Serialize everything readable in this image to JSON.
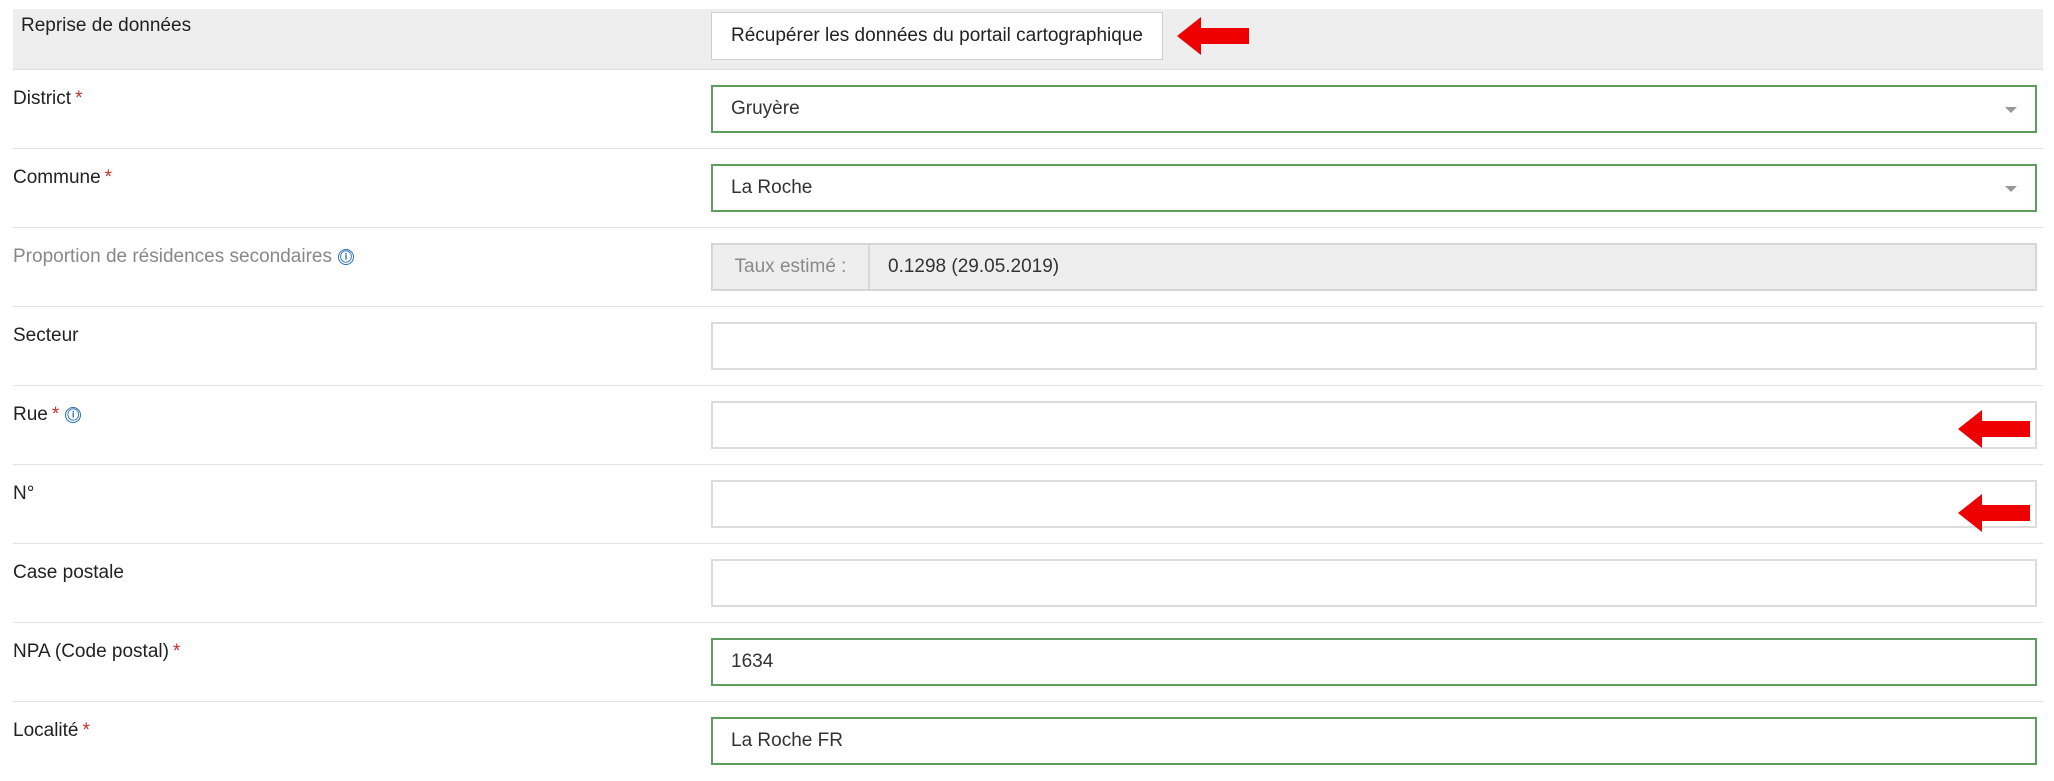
{
  "form": {
    "reprise": {
      "label": "Reprise de données",
      "button_label": "Récupérer les données du portail cartographique"
    },
    "district": {
      "label": "District",
      "required_mark": "*",
      "value": "Gruyère"
    },
    "commune": {
      "label": "Commune",
      "required_mark": "*",
      "value": "La Roche"
    },
    "proportion": {
      "label": "Proportion de résidences secondaires",
      "info_glyph": "ⓘ",
      "addon": "Taux estimé :",
      "value": "0.1298 (29.05.2019)"
    },
    "secteur": {
      "label": "Secteur",
      "value": ""
    },
    "rue": {
      "label": "Rue",
      "required_mark": "*",
      "info_glyph": "ⓘ",
      "value": ""
    },
    "numero": {
      "label": "N°",
      "value": ""
    },
    "case_postale": {
      "label": "Case postale",
      "value": ""
    },
    "npa": {
      "label": "NPA (Code postal)",
      "required_mark": "*",
      "value": "1634"
    },
    "localite": {
      "label": "Localité",
      "required_mark": "*",
      "value": "La Roche FR"
    }
  },
  "icons": {
    "info": "info-circle-icon",
    "caret": "caret-down-icon",
    "annotation": "red-arrow-left-icon"
  },
  "colors": {
    "valid_border": "#5e9d5e",
    "required": "#c9302c",
    "info": "#2a6fb0",
    "annotation_arrow": "#ee0000",
    "shaded_row": "#eeeeee"
  }
}
